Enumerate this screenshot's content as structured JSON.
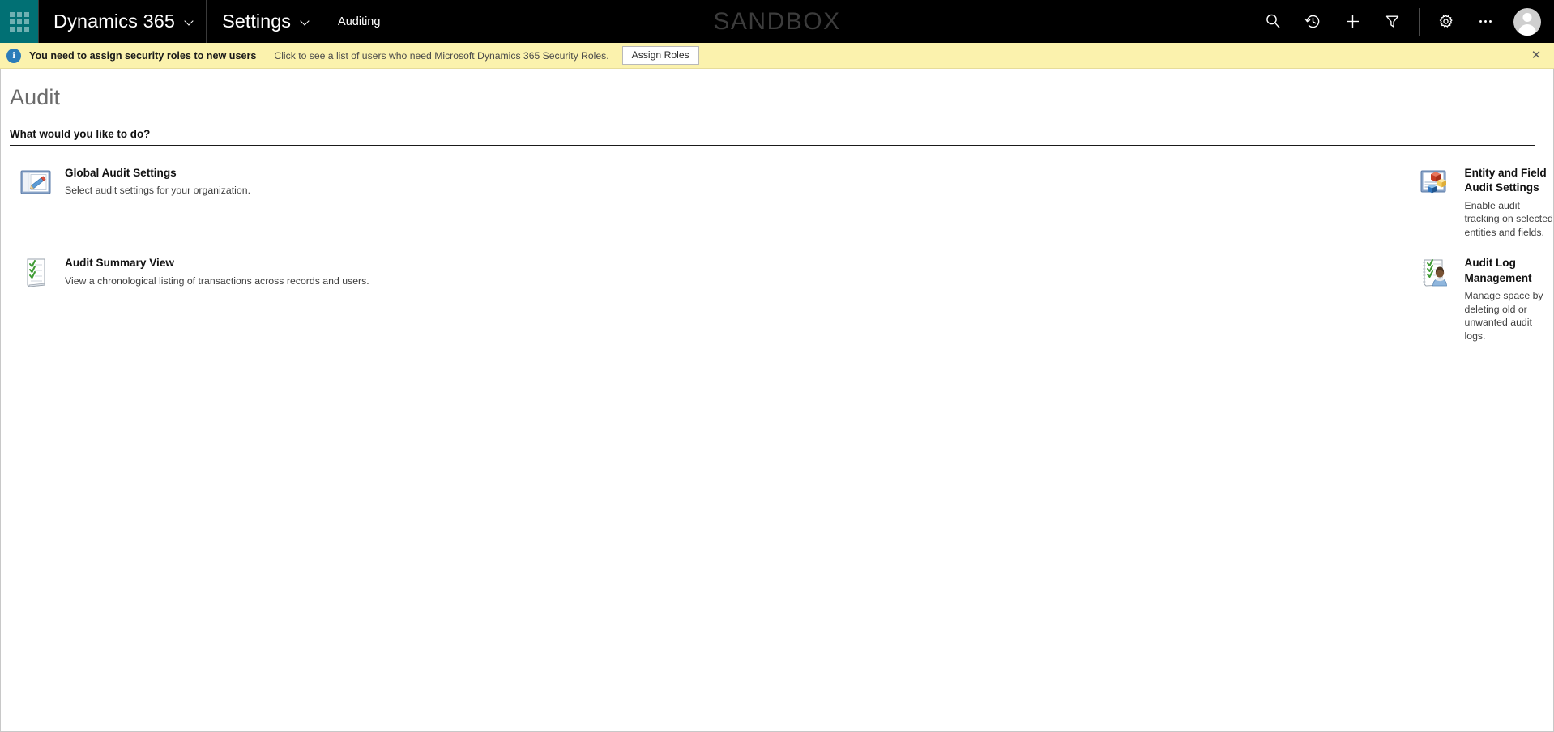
{
  "topbar": {
    "waffle_label": "app-launcher",
    "brand": "Dynamics 365",
    "area": "Settings",
    "subarea": "Auditing",
    "watermark": "SANDBOX",
    "icons": [
      {
        "name": "search-icon",
        "label": "Search"
      },
      {
        "name": "recent-history-icon",
        "label": "Recently viewed"
      },
      {
        "name": "quick-create-plus-icon",
        "label": "Quick create"
      },
      {
        "name": "advanced-find-filter-icon",
        "label": "Advanced find"
      },
      {
        "name": "settings-gear-icon",
        "label": "Settings"
      },
      {
        "name": "more-ellipsis-icon",
        "label": "More"
      }
    ],
    "avatar_label": "User profile"
  },
  "notification": {
    "icon": "info-icon",
    "title": "You need to assign security roles to new users",
    "message": "Click to see a list of users who need Microsoft Dynamics 365 Security Roles.",
    "action_label": "Assign Roles",
    "close_label": "✕",
    "background": "#fbf2ad"
  },
  "page": {
    "title": "Audit",
    "section_heading": "What would you like to do?",
    "tiles": [
      {
        "icon": "global-audit-settings-icon",
        "title": "Global Audit Settings",
        "description": "Select audit settings for your organization."
      },
      {
        "icon": "entity-field-audit-settings-icon",
        "title": "Entity and Field Audit Settings",
        "description": "Enable audit tracking on selected entities and fields."
      },
      {
        "icon": "audit-summary-view-icon",
        "title": "Audit Summary View",
        "description": "View a chronological listing of transactions across records and users."
      },
      {
        "icon": "audit-log-management-icon",
        "title": "Audit Log Management",
        "description": "Manage space by deleting old or unwanted audit logs."
      }
    ]
  },
  "colors": {
    "brand_teal": "#017074",
    "topbar_black": "#000000",
    "notification_yellow": "#fbf2ad",
    "title_gray": "#6b6b6b"
  }
}
